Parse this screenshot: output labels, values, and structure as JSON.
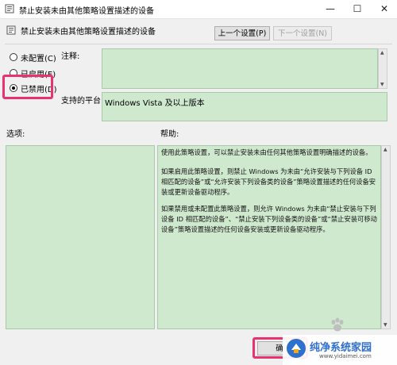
{
  "window": {
    "title": "禁止安装未由其他策略设置描述的设备",
    "controls": {
      "minimize": "—",
      "maximize": "☐",
      "close": "✕"
    }
  },
  "header": {
    "title": "禁止安装未由其他策略设置描述的设备",
    "prev_button": "上一个设置(P)",
    "next_button": "下一个设置(N)"
  },
  "state": {
    "options": [
      {
        "label": "未配置(C)",
        "selected": false
      },
      {
        "label": "已启用(E)",
        "selected": false
      },
      {
        "label": "已禁用(D)",
        "selected": true
      }
    ]
  },
  "comment": {
    "label": "注释:",
    "value": ""
  },
  "platform": {
    "label": "支持的平台:",
    "value": "Windows Vista 及以上版本"
  },
  "options_section": {
    "label": "选项:"
  },
  "help_section": {
    "label": "帮助:",
    "paragraphs": [
      "使用此策略设置，可以禁止安装未由任何其他策略设置明确描述的设备。",
      "如果启用此策略设置，则禁止 Windows 为未由“允许安装与下列设备 ID 相匹配的设备”或“允许安装下列设备类的设备”策略设置描述的任何设备安装或更新设备驱动程序。",
      "如果禁用或未配置此策略设置，则允许 Windows 为未由“禁止安装与下列设备 ID 相匹配的设备”、“禁止安装下列设备类的设备”或“禁止安装可移动设备”策略设置描述的任何设备安装或更新设备驱动程序。"
    ]
  },
  "footer": {
    "ok_button": "确"
  },
  "watermark": {
    "title": "纯净系统家园",
    "url": "www.yidaimei.com"
  },
  "colors": {
    "panel_green": "#cfe9cf",
    "highlight_pink": "#e8336f",
    "brand_blue": "#2f6fce"
  }
}
